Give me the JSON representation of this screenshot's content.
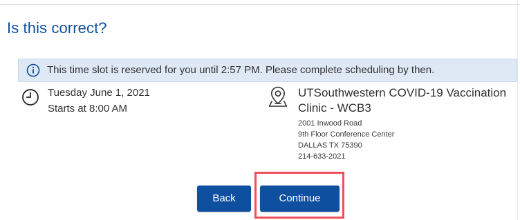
{
  "heading": "Is this correct?",
  "notice": {
    "icon": "info-icon",
    "text": "This time slot is reserved for you until 2:57 PM. Please complete scheduling by then."
  },
  "appointment": {
    "date_icon": "clock-icon",
    "date": "Tuesday June 1, 2021",
    "start": "Starts at 8:00 AM"
  },
  "location": {
    "icon": "location-icon",
    "name": "UTSouthwestern COVID-19 Vaccination Clinic - WCB3",
    "address_lines": [
      "2001 Inwood Road",
      "9th Floor Conference Center",
      "DALLAS TX 75390",
      "214-633-2021"
    ]
  },
  "actions": {
    "back_label": "Back",
    "continue_label": "Continue"
  },
  "colors": {
    "brand_blue": "#0f4f9f",
    "notice_bg": "#dfe9f6",
    "highlight": "#ee4f5a"
  }
}
